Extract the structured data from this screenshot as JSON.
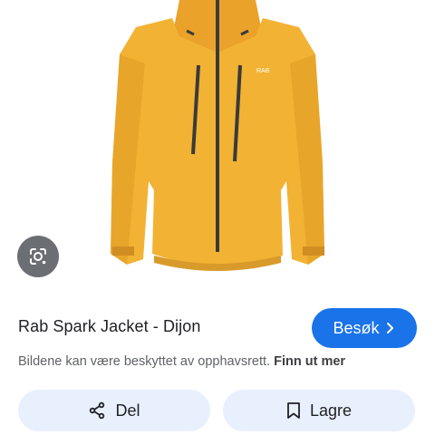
{
  "product": {
    "title": "Rab Spark Jacket - Dijon",
    "brand_mark": "RAB"
  },
  "visit_button": {
    "label": "Besøk",
    "icon": "chevron-right-icon"
  },
  "notice": {
    "text": "Bildene kan være beskyttet av opphavsrett.",
    "link": "Finn ut mer"
  },
  "actions": {
    "share_label": "Del",
    "share_icon": "share-icon",
    "save_label": "Lagre",
    "save_icon": "bookmark-icon"
  },
  "lens_icon": "google-lens-icon",
  "colors": {
    "accent": "#1a73e8",
    "pill_bg": "#e8f0fe",
    "jacket": "#f2b233"
  }
}
